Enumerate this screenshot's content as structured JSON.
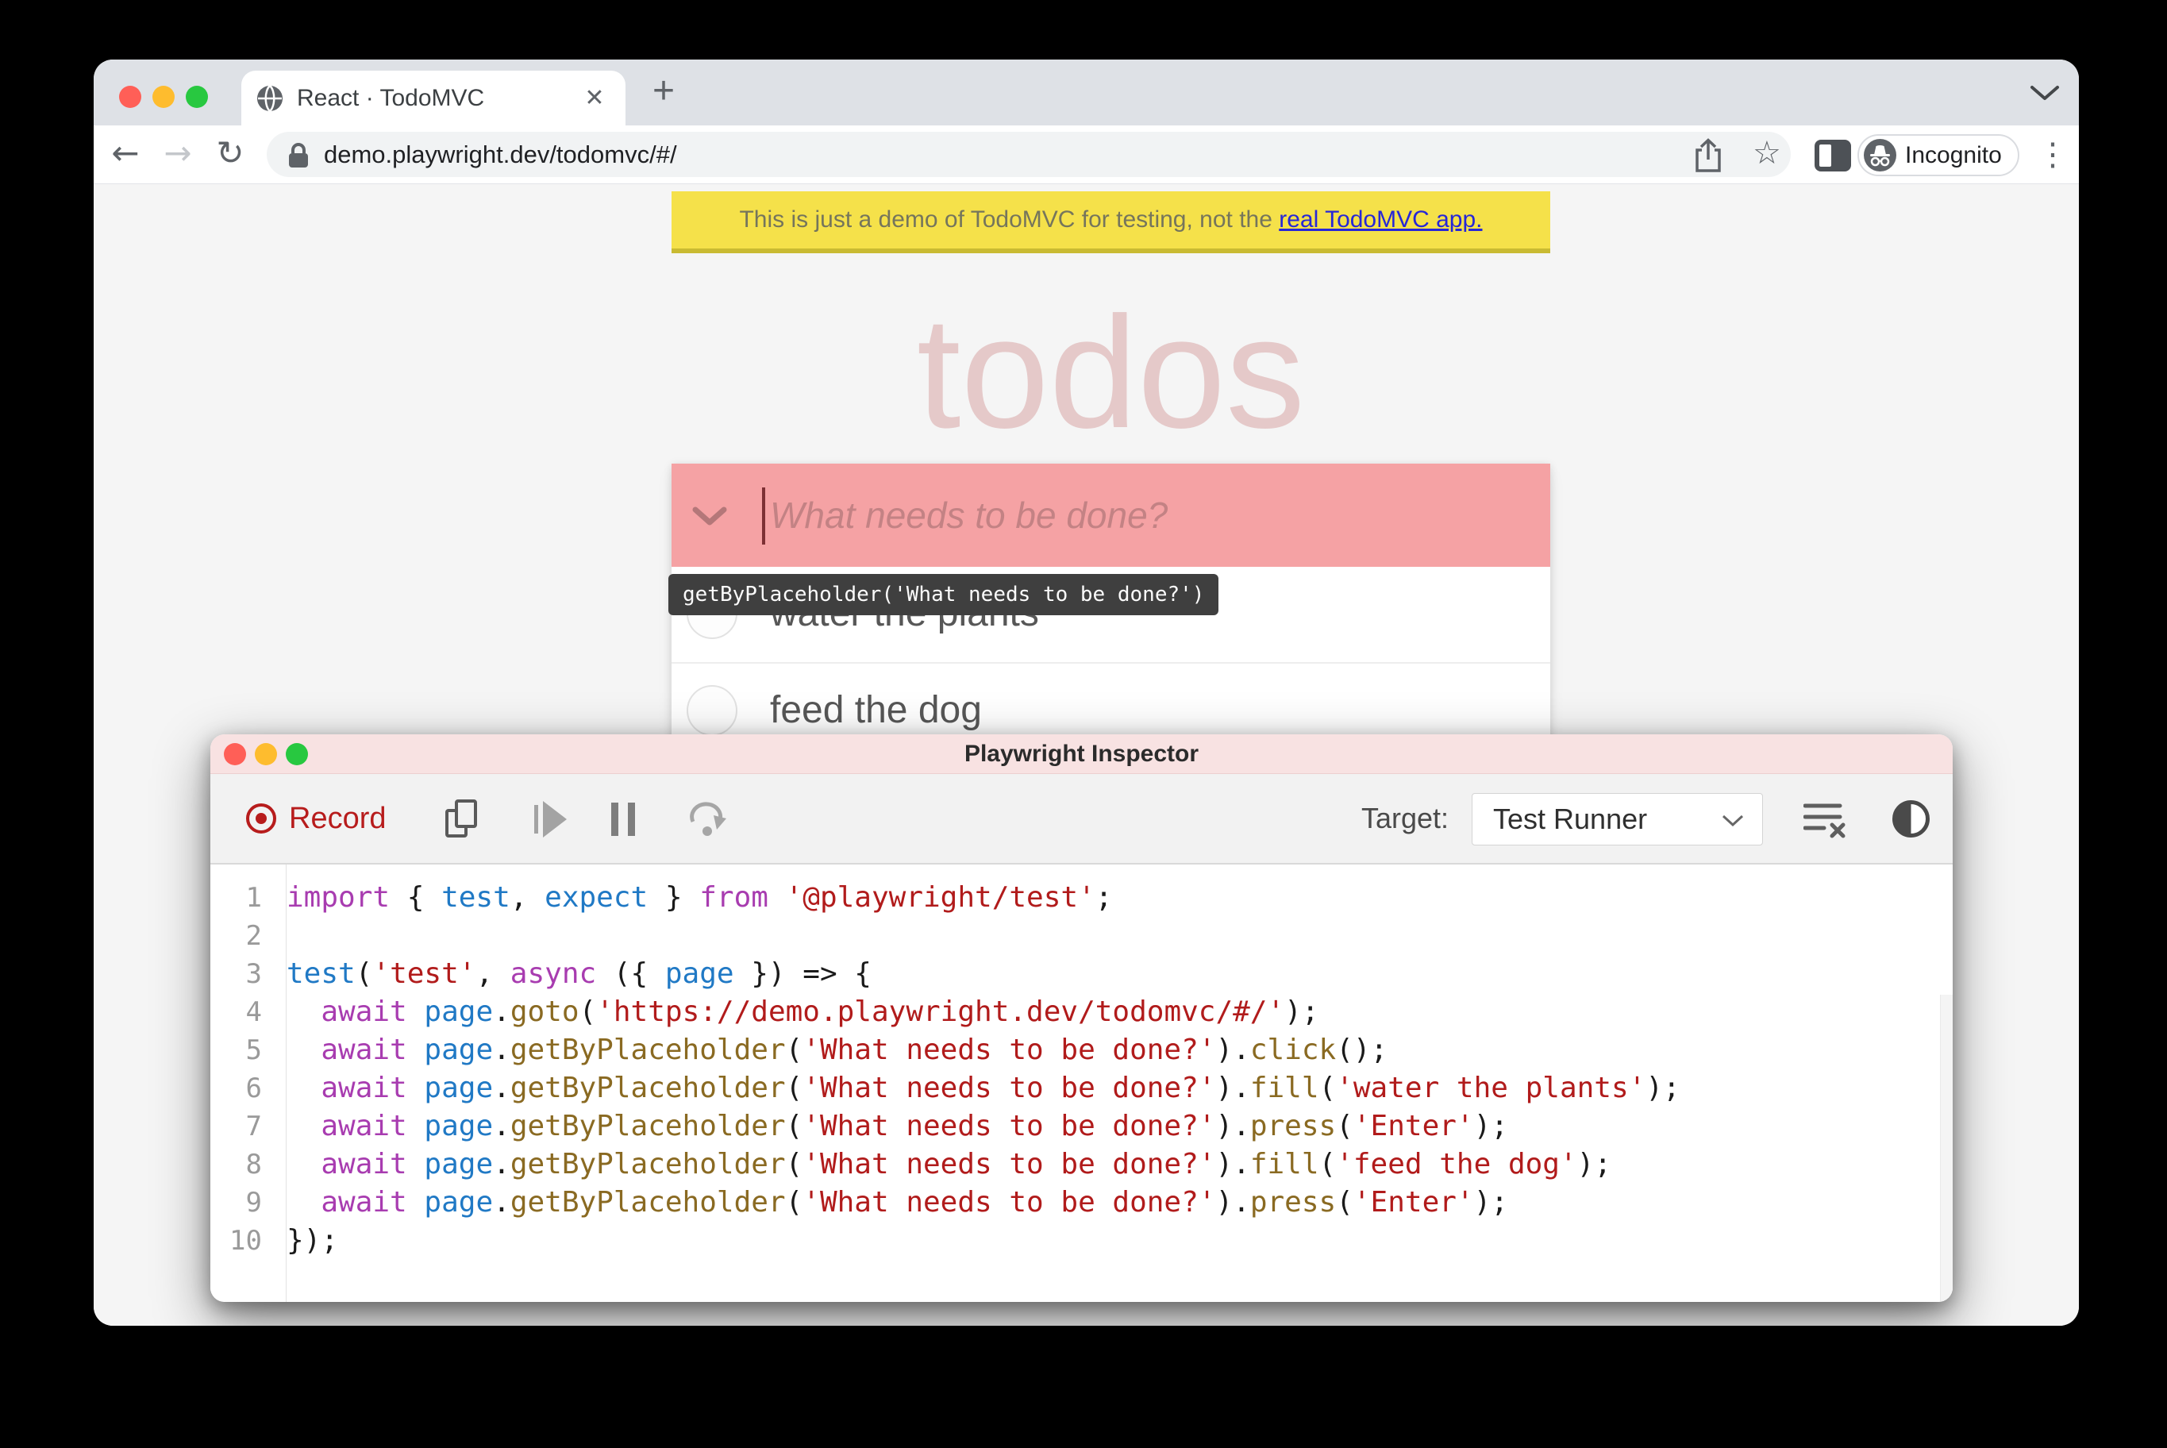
{
  "colors": {
    "record_red": "#b71c1c",
    "highlight_pink": "#f5a2a4",
    "banner_yellow": "#f5e14a",
    "inspector_titlebar_pink": "#f8e2e2",
    "code_keyword": "#a83cb0",
    "code_variable": "#2079c5",
    "code_property": "#8a6a22",
    "code_string": "#b11b1b"
  },
  "browser": {
    "tab_title": "React · TodoMVC",
    "url": "demo.playwright.dev/todomvc/#/",
    "incognito_label": "Incognito"
  },
  "icons": {
    "back": "←",
    "forward": "→",
    "reload": "↻",
    "close": "✕",
    "new_tab": "+",
    "star": "☆",
    "more": "⋮"
  },
  "page": {
    "banner_text": "This is just a demo of TodoMVC for testing, not the ",
    "banner_link": "real TodoMVC app.",
    "title": "todos",
    "input_placeholder": "What needs to be done?",
    "tooltip": "getByPlaceholder('What needs to be done?')",
    "todos": [
      "water the plants",
      "feed the dog"
    ]
  },
  "inspector": {
    "title": "Playwright Inspector",
    "record_label": "Record",
    "target_label": "Target:",
    "target_value": "Test Runner",
    "code": {
      "lines": [
        {
          "n": "1",
          "tokens": [
            [
              "kw",
              "import"
            ],
            [
              "pln",
              " { "
            ],
            [
              "def",
              "test"
            ],
            [
              "pln",
              ", "
            ],
            [
              "def",
              "expect"
            ],
            [
              "pln",
              " } "
            ],
            [
              "kw",
              "from"
            ],
            [
              "pln",
              " "
            ],
            [
              "str",
              "'@playwright/test'"
            ],
            [
              "pln",
              ";"
            ]
          ]
        },
        {
          "n": "2",
          "tokens": []
        },
        {
          "n": "3",
          "tokens": [
            [
              "def",
              "test"
            ],
            [
              "pln",
              "("
            ],
            [
              "str",
              "'test'"
            ],
            [
              "pln",
              ", "
            ],
            [
              "kw",
              "async"
            ],
            [
              "pln",
              " ({ "
            ],
            [
              "def",
              "page"
            ],
            [
              "pln",
              " }) => {"
            ]
          ]
        },
        {
          "n": "4",
          "tokens": [
            [
              "pln",
              "  "
            ],
            [
              "kw",
              "await"
            ],
            [
              "pln",
              " "
            ],
            [
              "def",
              "page"
            ],
            [
              "pln",
              "."
            ],
            [
              "prop",
              "goto"
            ],
            [
              "pln",
              "("
            ],
            [
              "str",
              "'https://demo.playwright.dev/todomvc/#/'"
            ],
            [
              "pln",
              ");"
            ]
          ]
        },
        {
          "n": "5",
          "tokens": [
            [
              "pln",
              "  "
            ],
            [
              "kw",
              "await"
            ],
            [
              "pln",
              " "
            ],
            [
              "def",
              "page"
            ],
            [
              "pln",
              "."
            ],
            [
              "prop",
              "getByPlaceholder"
            ],
            [
              "pln",
              "("
            ],
            [
              "str",
              "'What needs to be done?'"
            ],
            [
              "pln",
              ")."
            ],
            [
              "prop",
              "click"
            ],
            [
              "pln",
              "();"
            ]
          ]
        },
        {
          "n": "6",
          "tokens": [
            [
              "pln",
              "  "
            ],
            [
              "kw",
              "await"
            ],
            [
              "pln",
              " "
            ],
            [
              "def",
              "page"
            ],
            [
              "pln",
              "."
            ],
            [
              "prop",
              "getByPlaceholder"
            ],
            [
              "pln",
              "("
            ],
            [
              "str",
              "'What needs to be done?'"
            ],
            [
              "pln",
              ")."
            ],
            [
              "prop",
              "fill"
            ],
            [
              "pln",
              "("
            ],
            [
              "str",
              "'water the plants'"
            ],
            [
              "pln",
              ");"
            ]
          ]
        },
        {
          "n": "7",
          "tokens": [
            [
              "pln",
              "  "
            ],
            [
              "kw",
              "await"
            ],
            [
              "pln",
              " "
            ],
            [
              "def",
              "page"
            ],
            [
              "pln",
              "."
            ],
            [
              "prop",
              "getByPlaceholder"
            ],
            [
              "pln",
              "("
            ],
            [
              "str",
              "'What needs to be done?'"
            ],
            [
              "pln",
              ")."
            ],
            [
              "prop",
              "press"
            ],
            [
              "pln",
              "("
            ],
            [
              "str",
              "'Enter'"
            ],
            [
              "pln",
              ");"
            ]
          ]
        },
        {
          "n": "8",
          "tokens": [
            [
              "pln",
              "  "
            ],
            [
              "kw",
              "await"
            ],
            [
              "pln",
              " "
            ],
            [
              "def",
              "page"
            ],
            [
              "pln",
              "."
            ],
            [
              "prop",
              "getByPlaceholder"
            ],
            [
              "pln",
              "("
            ],
            [
              "str",
              "'What needs to be done?'"
            ],
            [
              "pln",
              ")."
            ],
            [
              "prop",
              "fill"
            ],
            [
              "pln",
              "("
            ],
            [
              "str",
              "'feed the dog'"
            ],
            [
              "pln",
              ");"
            ]
          ]
        },
        {
          "n": "9",
          "tokens": [
            [
              "pln",
              "  "
            ],
            [
              "kw",
              "await"
            ],
            [
              "pln",
              " "
            ],
            [
              "def",
              "page"
            ],
            [
              "pln",
              "."
            ],
            [
              "prop",
              "getByPlaceholder"
            ],
            [
              "pln",
              "("
            ],
            [
              "str",
              "'What needs to be done?'"
            ],
            [
              "pln",
              ")."
            ],
            [
              "prop",
              "press"
            ],
            [
              "pln",
              "("
            ],
            [
              "str",
              "'Enter'"
            ],
            [
              "pln",
              ");"
            ]
          ]
        },
        {
          "n": "10",
          "tokens": [
            [
              "pln",
              "});"
            ]
          ]
        }
      ]
    }
  }
}
